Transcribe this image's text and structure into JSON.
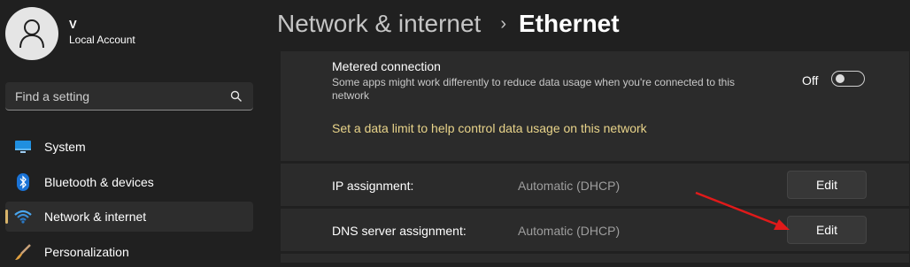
{
  "account": {
    "name": "V",
    "type": "Local Account"
  },
  "search": {
    "placeholder": "Find a setting"
  },
  "nav": {
    "items": [
      {
        "label": "System",
        "icon": "monitor-icon"
      },
      {
        "label": "Bluetooth & devices",
        "icon": "bluetooth-icon"
      },
      {
        "label": "Network & internet",
        "icon": "wifi-icon",
        "selected": true
      },
      {
        "label": "Personalization",
        "icon": "brush-icon"
      }
    ]
  },
  "header": {
    "parent": "Network & internet",
    "separator": "›",
    "current": "Ethernet"
  },
  "metered": {
    "title": "Metered connection",
    "description": "Some apps might work differently to reduce data usage when you're connected to this network",
    "toggle_state": "Off",
    "data_limit_link": "Set a data limit to help control data usage on this network"
  },
  "ip_assignment": {
    "label": "IP assignment:",
    "value": "Automatic (DHCP)",
    "button": "Edit"
  },
  "dns_assignment": {
    "label": "DNS server assignment:",
    "value": "Automatic (DHCP)",
    "button": "Edit"
  },
  "colors": {
    "accent": "#d8b46a",
    "link": "#e9d48a",
    "annotation_arrow": "#e01a1a"
  }
}
